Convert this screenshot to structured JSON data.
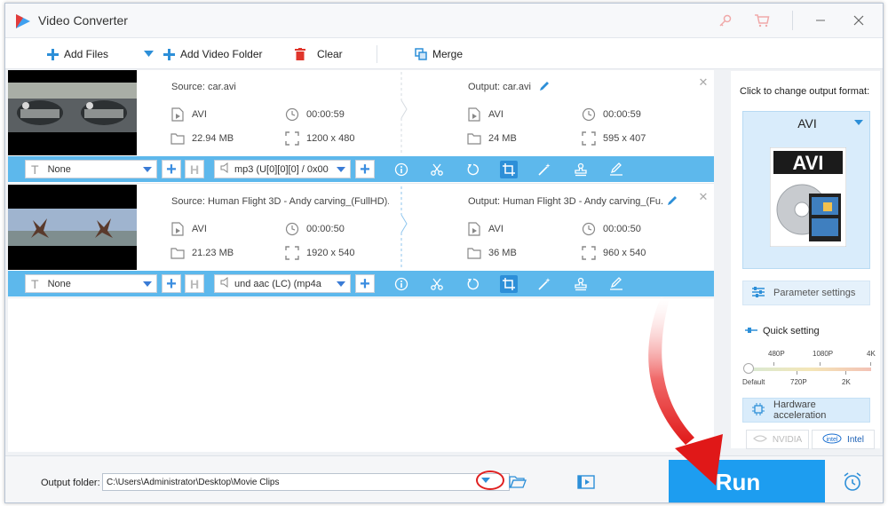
{
  "app": {
    "title": "Video Converter"
  },
  "toolbar": {
    "add_files": "Add Files",
    "add_video_folder": "Add Video Folder",
    "clear": "Clear",
    "merge": "Merge"
  },
  "tasks": [
    {
      "source_label": "Source: car.avi",
      "source": {
        "format": "AVI",
        "duration": "00:00:59",
        "size": "22.94 MB",
        "resolution": "1200 x 480"
      },
      "output_label": "Output: car.avi",
      "output": {
        "format": "AVI",
        "duration": "00:00:59",
        "size": "24 MB",
        "resolution": "595 x 407"
      },
      "subtitle": "None",
      "audio": "mp3 (U[0][0][0] / 0x00"
    },
    {
      "source_label": "Source: Human Flight 3D - Andy carving_(FullHD)....",
      "source": {
        "format": "AVI",
        "duration": "00:00:50",
        "size": "21.23 MB",
        "resolution": "1920 x 540"
      },
      "output_label": "Output: Human Flight 3D - Andy carving_(Fu...",
      "output": {
        "format": "AVI",
        "duration": "00:00:50",
        "size": "36 MB",
        "resolution": "960 x 540"
      },
      "subtitle": "None",
      "audio": "und aac (LC) (mp4a"
    }
  ],
  "right_panel": {
    "change_format_label": "Click to change output format:",
    "format_name": "AVI",
    "format_art_text": "AVI",
    "parameter_settings": "Parameter settings",
    "quick_setting": "Quick setting",
    "quality_top": [
      "480P",
      "1080P",
      "4K"
    ],
    "quality_bottom": [
      "Default",
      "720P",
      "2K"
    ],
    "quality_level": 0,
    "hardware_acceleration": "Hardware acceleration",
    "nvidia": "NVIDIA",
    "intel": "Intel"
  },
  "bottom": {
    "output_folder_label": "Output folder:",
    "output_folder_value": "C:\\Users\\Administrator\\Desktop\\Movie Clips",
    "run": "Run"
  },
  "colors": {
    "accent": "#1d9df0",
    "edit_bar": "#5db8ec",
    "annotation_red": "#e02020"
  }
}
